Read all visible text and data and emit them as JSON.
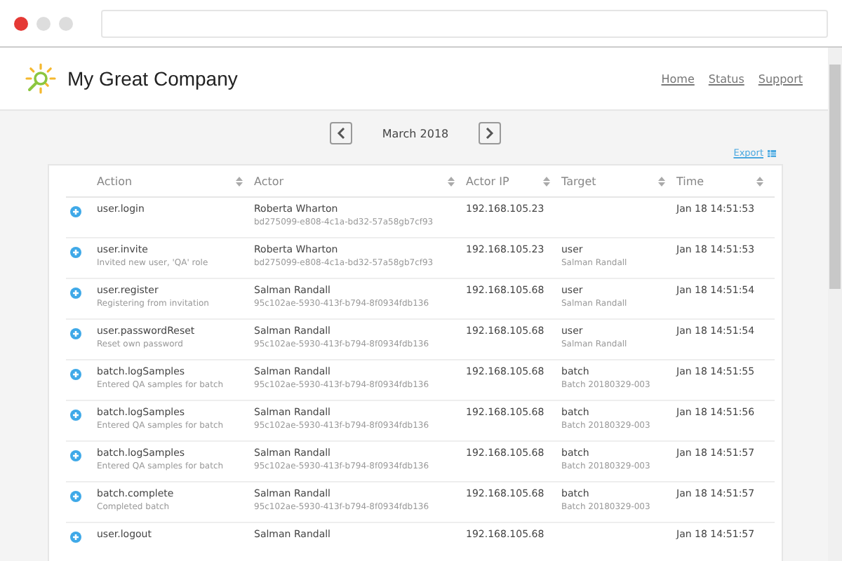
{
  "brand": {
    "name": "My Great Company"
  },
  "nav": [
    "Home",
    "Status",
    "Support"
  ],
  "month_nav": {
    "label": "March 2018"
  },
  "export": {
    "label": "Export"
  },
  "table": {
    "columns": [
      "Action",
      "Actor",
      "Actor IP",
      "Target",
      "Time"
    ],
    "rows": [
      {
        "action": "user.login",
        "description": "",
        "actor": "Roberta Wharton",
        "actor_id": "bd275099-e808-4c1a-bd32-57a58gb7cf93",
        "ip": "192.168.105.23",
        "target": "",
        "target_detail": "",
        "time": "Jan 18 14:51:53"
      },
      {
        "action": "user.invite",
        "description": "Invited new user, 'QA' role",
        "actor": "Roberta Wharton",
        "actor_id": "bd275099-e808-4c1a-bd32-57a58gb7cf93",
        "ip": "192.168.105.23",
        "target": "user",
        "target_detail": "Salman Randall",
        "time": "Jan 18 14:51:53"
      },
      {
        "action": "user.register",
        "description": "Registering from invitation",
        "actor": "Salman Randall",
        "actor_id": "95c102ae-5930-413f-b794-8f0934fdb136",
        "ip": "192.168.105.68",
        "target": "user",
        "target_detail": "Salman Randall",
        "time": "Jan 18 14:51:54"
      },
      {
        "action": "user.passwordReset",
        "description": "Reset own password",
        "actor": "Salman Randall",
        "actor_id": "95c102ae-5930-413f-b794-8f0934fdb136",
        "ip": "192.168.105.68",
        "target": "user",
        "target_detail": "Salman Randall",
        "time": "Jan 18 14:51:54"
      },
      {
        "action": "batch.logSamples",
        "description": "Entered QA samples for batch",
        "actor": "Salman Randall",
        "actor_id": "95c102ae-5930-413f-b794-8f0934fdb136",
        "ip": "192.168.105.68",
        "target": "batch",
        "target_detail": "Batch 20180329-003",
        "time": "Jan 18 14:51:55"
      },
      {
        "action": "batch.logSamples",
        "description": "Entered QA samples for batch",
        "actor": "Salman Randall",
        "actor_id": "95c102ae-5930-413f-b794-8f0934fdb136",
        "ip": "192.168.105.68",
        "target": "batch",
        "target_detail": "Batch 20180329-003",
        "time": "Jan 18 14:51:56"
      },
      {
        "action": "batch.logSamples",
        "description": "Entered QA samples for batch",
        "actor": "Salman Randall",
        "actor_id": "95c102ae-5930-413f-b794-8f0934fdb136",
        "ip": "192.168.105.68",
        "target": "batch",
        "target_detail": "Batch 20180329-003",
        "time": "Jan 18 14:51:57"
      },
      {
        "action": "batch.complete",
        "description": "Completed batch",
        "actor": "Salman Randall",
        "actor_id": "95c102ae-5930-413f-b794-8f0934fdb136",
        "ip": "192.168.105.68",
        "target": "batch",
        "target_detail": "Batch 20180329-003",
        "time": "Jan 18 14:51:57"
      },
      {
        "action": "user.logout",
        "description": "",
        "actor": "Salman Randall",
        "actor_id": "",
        "ip": "192.168.105.68",
        "target": "",
        "target_detail": "",
        "time": "Jan 18 14:51:57"
      }
    ]
  }
}
